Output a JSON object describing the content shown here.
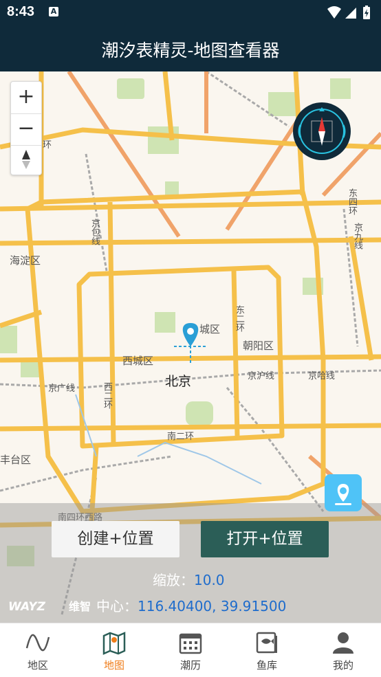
{
  "status_bar": {
    "time": "8:43",
    "notification_icon": "A"
  },
  "app": {
    "title": "潮汐表精灵-地图查看器"
  },
  "map": {
    "labels": {
      "city": "北京",
      "haidian": "海淀区",
      "xicheng": "西城区",
      "dongcheng": "城区",
      "chaoyang": "朝阳区",
      "fengtai": "丰台区",
      "dong_er_huan": "东二环",
      "xi_er_huan": "西二环",
      "nan_er_huan": "南二环",
      "nan_si_huan": "南四环西路",
      "jingguang": "京广线",
      "jinghu": "京沪线",
      "jingha": "京哈线",
      "dongsi": "东四环",
      "xi_huan": "环",
      "jingbao": "京包线",
      "jingjiu": "京九线"
    },
    "zoom_controls": {
      "plus": "+",
      "minus": "−"
    }
  },
  "actions": {
    "create_label": "创建+位置",
    "open_label": "打开+位置"
  },
  "info": {
    "zoom_label": "缩放：",
    "zoom_value": "10.0",
    "center_label": "中心：",
    "center_value": "116.40400, 39.91500",
    "brand": "WAYZ 维智"
  },
  "tabs": [
    {
      "label": "地区",
      "icon": "wave-icon"
    },
    {
      "label": "地图",
      "icon": "map-icon"
    },
    {
      "label": "潮历",
      "icon": "calendar-icon"
    },
    {
      "label": "鱼库",
      "icon": "fish-book-icon"
    },
    {
      "label": "我的",
      "icon": "user-icon"
    }
  ],
  "colors": {
    "header": "#0f2a3a",
    "accent": "#ef7d1a",
    "open_button": "#2b5e57",
    "road": "#f5c04a",
    "value_text": "#1e6ccc"
  }
}
